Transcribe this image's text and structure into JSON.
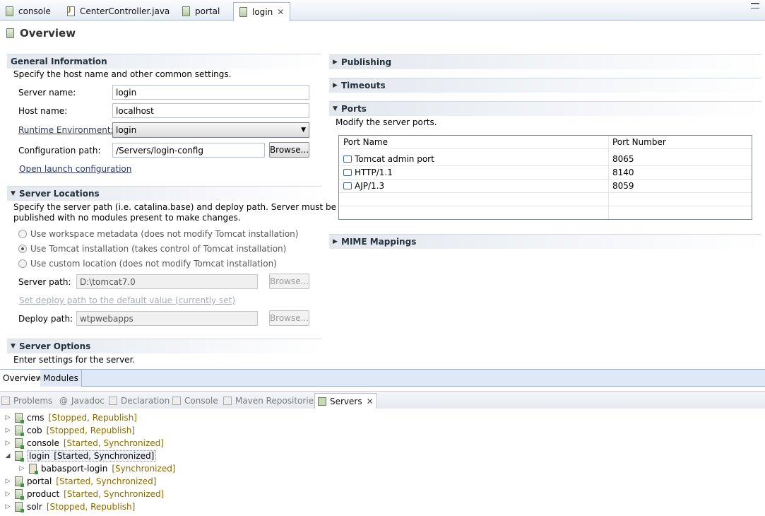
{
  "editor_tabs": [
    {
      "label": "console",
      "icon": "server-icon"
    },
    {
      "label": "CenterController.java",
      "icon": "java-file-icon"
    },
    {
      "label": "portal",
      "icon": "server-icon"
    },
    {
      "label": "login",
      "icon": "server-icon",
      "active": true
    }
  ],
  "overview": {
    "title": "Overview"
  },
  "general": {
    "title": "General Information",
    "desc": "Specify the host name and other common settings.",
    "server_name_label": "Server name:",
    "server_name_value": "login",
    "host_name_label": "Host name:",
    "host_name_value": "localhost",
    "runtime_label": "Runtime Environment:",
    "runtime_value": "login",
    "config_path_label": "Configuration path:",
    "config_path_value": "/Servers/login-config",
    "browse": "Browse...",
    "open_launch": "Open launch configuration"
  },
  "locations": {
    "title": "Server Locations",
    "desc1": "Specify the server path (i.e. catalina.base) and deploy path. Server must be",
    "desc2": "published with no modules present to make changes.",
    "radio1": "Use workspace metadata (does not modify Tomcat installation)",
    "radio2": "Use Tomcat installation (takes control of Tomcat installation)",
    "radio3": "Use custom location (does not modify Tomcat installation)",
    "server_path_label": "Server path:",
    "server_path_value": "D:\\tomcat7.0",
    "set_default": "Set deploy path to the default value (currently set)",
    "deploy_path_label": "Deploy path:",
    "deploy_path_value": "wtpwebapps",
    "browse": "Browse..."
  },
  "options": {
    "title": "Server Options",
    "desc": "Enter settings for the server."
  },
  "right": {
    "publishing": "Publishing",
    "timeouts": "Timeouts",
    "ports_title": "Ports",
    "ports_desc": "Modify the server ports.",
    "col_name": "Port Name",
    "col_number": "Port Number",
    "ports": [
      {
        "name": "Tomcat admin port",
        "number": "8065"
      },
      {
        "name": "HTTP/1.1",
        "number": "8140"
      },
      {
        "name": "AJP/1.3",
        "number": "8059"
      }
    ],
    "mime": "MIME Mappings"
  },
  "page_tabs": {
    "overview": "Overview",
    "modules": "Modules"
  },
  "view_tabs": [
    "Problems",
    "Javadoc",
    "Declaration",
    "Console",
    "Maven Repositories",
    "Servers"
  ],
  "servers": [
    {
      "name": "cms",
      "status": "[Stopped, Republish]"
    },
    {
      "name": "cob",
      "status": "[Stopped, Republish]"
    },
    {
      "name": "console",
      "status": "[Started, Synchronized]"
    },
    {
      "name": "login",
      "status": "[Started, Synchronized]"
    },
    {
      "name": "babasport-login",
      "status": "[Synchronized]"
    },
    {
      "name": "portal",
      "status": "[Started, Synchronized]"
    },
    {
      "name": "product",
      "status": "[Started, Synchronized]"
    },
    {
      "name": "solr",
      "status": "[Stopped, Republish]"
    }
  ]
}
